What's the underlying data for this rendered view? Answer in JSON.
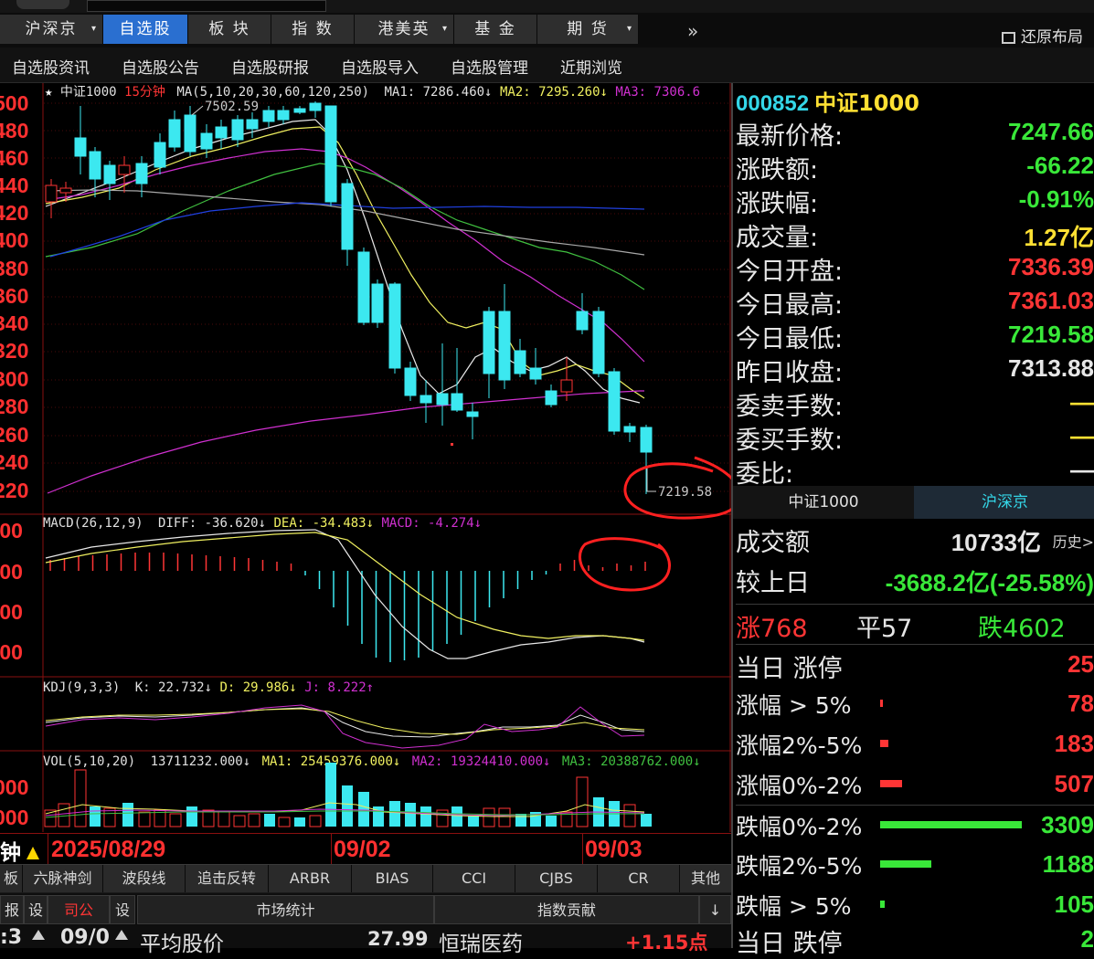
{
  "top_tabs": [
    {
      "label": "沪深京",
      "caret": "▾",
      "active": false
    },
    {
      "label": "自选股",
      "caret": "",
      "active": true
    },
    {
      "label": "板 块",
      "caret": "",
      "active": false
    },
    {
      "label": "指 数",
      "caret": "",
      "active": false
    },
    {
      "label": "港美英",
      "caret": "▾",
      "active": false
    },
    {
      "label": "基 金",
      "caret": "",
      "active": false
    },
    {
      "label": "期 货",
      "caret": "▾",
      "active": false
    }
  ],
  "more_label": "»",
  "restore_label": "还原布局",
  "subnav": [
    "自选股资讯",
    "自选股公告",
    "自选股研报",
    "自选股导入",
    "自选股管理",
    "近期浏览"
  ],
  "chart_header": {
    "star": "★",
    "name": "中证1000",
    "period": "15分钟",
    "ma_def": "MA(5,10,20,30,60,120,250)",
    "ma1": "MA1: 7286.460↓",
    "ma2": "MA2: 7295.260↓",
    "ma3": "MA3: 7306.6"
  },
  "macd_header": {
    "def": "MACD(26,12,9)",
    "diff": "DIFF: -36.620↓",
    "dea": "DEA: -34.483↓",
    "macd": "MACD: -4.274↓"
  },
  "kdj_header": {
    "def": "KDJ(9,3,3)",
    "k": "K: 22.732↓",
    "d": "D: 29.986↓",
    "j": "J: 8.222↑"
  },
  "vol_header": {
    "def": "VOL(5,10,20)",
    "vol": "13711232.000↓",
    "ma1": "MA1: 25459376.000↓",
    "ma2": "MA2: 19324410.000↓",
    "ma3": "MA3: 20388762.000↓"
  },
  "annotations": {
    "high": "7502.59",
    "low": "7219.58"
  },
  "price_axis_labels": [
    "500",
    "480",
    "460",
    "440",
    "420",
    "400",
    "380",
    "360",
    "340",
    "320",
    "300",
    "280",
    "260",
    "240",
    "220"
  ],
  "macd_axis_labels": [
    ".00",
    ".00",
    ".00",
    ".00"
  ],
  "vol_axis_labels": [
    "000",
    "000"
  ],
  "date_labels": [
    "2025/08/29",
    "09/02",
    "09/03"
  ],
  "period_short": "钟",
  "indicator_tabs": [
    "板",
    "六脉神剑",
    "波段线",
    "追击反转",
    "ARBR",
    "BIAS",
    "CCI",
    "CJBS",
    "CR",
    "其他"
  ],
  "bottom_bar": {
    "btn1": "报",
    "btn2": "设",
    "btn3": "司公",
    "btn4": "设",
    "tab1": "市场统计",
    "tab2": "指数贡献",
    "arrow": "↓",
    "row_time": ":3",
    "row_date": "09/0",
    "row_label1": "平均股价",
    "row_val1": "27.99",
    "row_label2": "恒瑞医药",
    "row_val2": "+1.15点"
  },
  "right_panel": {
    "code": "000852",
    "name": "中证1000",
    "quotes": [
      {
        "label": "最新价格:",
        "value": "7247.66",
        "color": "green"
      },
      {
        "label": "涨跌额:",
        "value": "-66.22",
        "color": "green"
      },
      {
        "label": "涨跌幅:",
        "value": "-0.91%",
        "color": "green"
      },
      {
        "label": "成交量:",
        "value": "1.27亿",
        "color": "yellow"
      },
      {
        "label": "今日开盘:",
        "value": "7336.39",
        "color": "red"
      },
      {
        "label": "今日最高:",
        "value": "7361.03",
        "color": "red"
      },
      {
        "label": "今日最低:",
        "value": "7219.58",
        "color": "green"
      },
      {
        "label": "昨日收盘:",
        "value": "7313.88",
        "color": "white"
      },
      {
        "label": "委卖手数:",
        "value": "—",
        "color": "yellow"
      },
      {
        "label": "委买手数:",
        "value": "—",
        "color": "yellow"
      },
      {
        "label": "委比:",
        "value": "—",
        "color": "white"
      }
    ],
    "tabs": [
      "中证1000",
      "沪深京"
    ],
    "turnover_label": "成交额",
    "turnover_value": "10733亿",
    "history": "历史>",
    "vs_label": "较上日",
    "vs_value": "-3688.2亿(-25.58%)",
    "up_label": "涨768",
    "flat_label": "平57",
    "down_label": "跌4602",
    "limit_up_label": "当日 涨停",
    "limit_up_value": "25",
    "dist": [
      {
        "label": "涨幅 > 5%",
        "value": "78",
        "color": "red",
        "fraction": 0.02
      },
      {
        "label": "涨幅2%-5%",
        "value": "183",
        "color": "red",
        "fraction": 0.055
      },
      {
        "label": "涨幅0%-2%",
        "value": "507",
        "color": "red",
        "fraction": 0.153
      },
      {
        "label": "跌幅0%-2%",
        "value": "3309",
        "color": "green",
        "fraction": 1.0
      },
      {
        "label": "跌幅2%-5%",
        "value": "1188",
        "color": "green",
        "fraction": 0.359
      },
      {
        "label": "跌幅 > 5%",
        "value": "105",
        "color": "green",
        "fraction": 0.032
      }
    ],
    "limit_down_label": "当日 跌停",
    "limit_down_value": "2"
  },
  "colors": {
    "up": "#ff3535",
    "down": "#3ce8f0",
    "ma_yellow": "#f0f060",
    "ma_magenta": "#d030d0",
    "ma_green": "#40c040",
    "ma_blue": "#2040e0",
    "ma_gray": "#b0b0b0"
  }
}
